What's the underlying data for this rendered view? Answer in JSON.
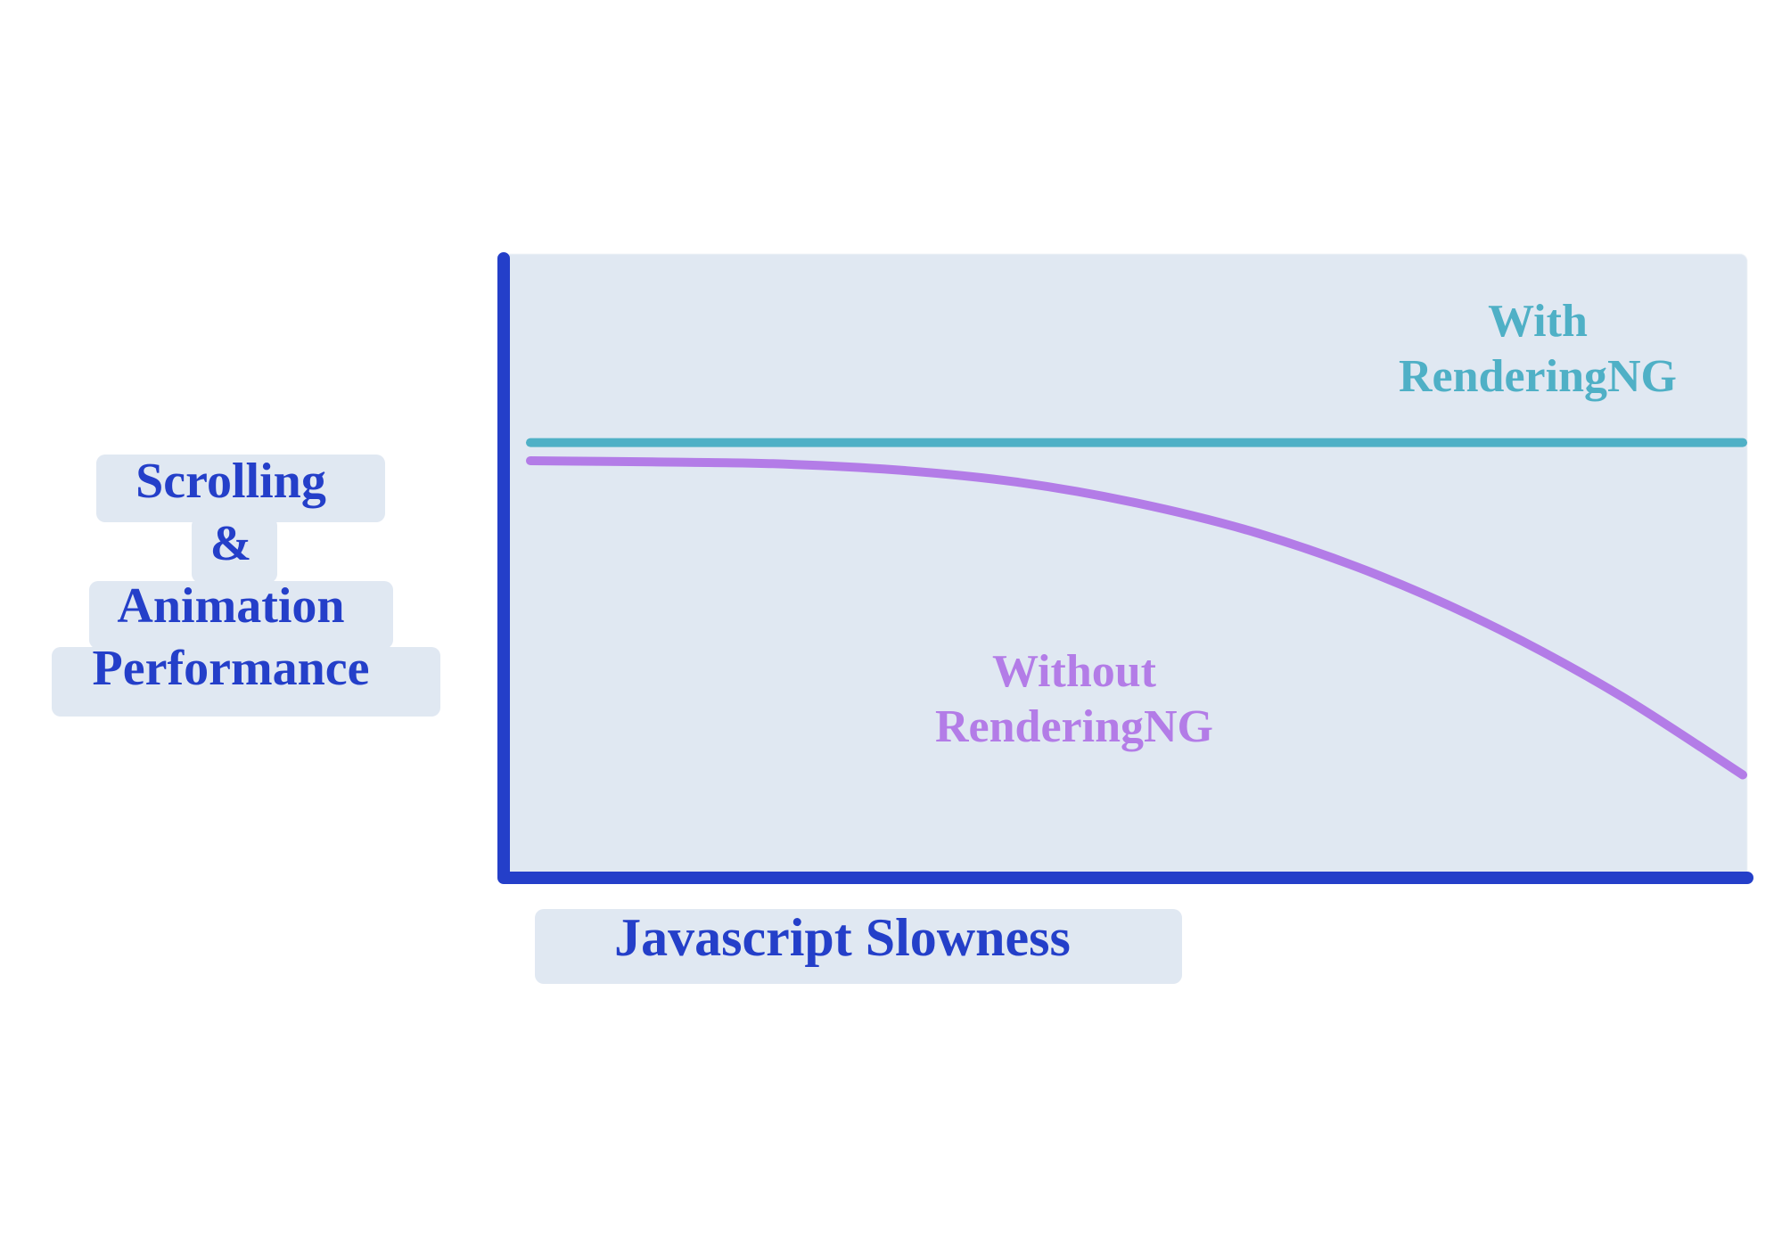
{
  "ylabel_lines": [
    "Scrolling",
    "&",
    "Animation",
    "Performance"
  ],
  "xlabel": "Javascript Slowness",
  "series_with_lines": [
    "With",
    "RenderingNG"
  ],
  "series_without_lines": [
    "Without",
    "RenderingNG"
  ],
  "colors": {
    "axis": "#243fc9",
    "plot_bg": "#e0e8f2",
    "teal": "#4fb0c6",
    "purple": "#b37ce7"
  },
  "chart_data": {
    "type": "line",
    "title": "",
    "xlabel": "Javascript Slowness",
    "ylabel": "Scrolling & Animation Performance",
    "xlim": [
      0,
      10
    ],
    "ylim": [
      0,
      10
    ],
    "legend": [
      "With RenderingNG",
      "Without RenderingNG"
    ],
    "series": [
      {
        "name": "With RenderingNG",
        "color": "#4fb0c6",
        "x": [
          0,
          1,
          2,
          3,
          4,
          5,
          6,
          7,
          8,
          9,
          10
        ],
        "values": [
          7.1,
          7.1,
          7.1,
          7.1,
          7.1,
          7.1,
          7.1,
          7.1,
          7.1,
          7.1,
          7.1
        ]
      },
      {
        "name": "Without RenderingNG",
        "color": "#b37ce7",
        "x": [
          0,
          1,
          2,
          3,
          4,
          5,
          6,
          7,
          8,
          9,
          10
        ],
        "values": [
          6.8,
          6.78,
          6.75,
          6.65,
          6.45,
          6.1,
          5.6,
          4.9,
          4.0,
          2.9,
          1.6
        ]
      }
    ]
  }
}
